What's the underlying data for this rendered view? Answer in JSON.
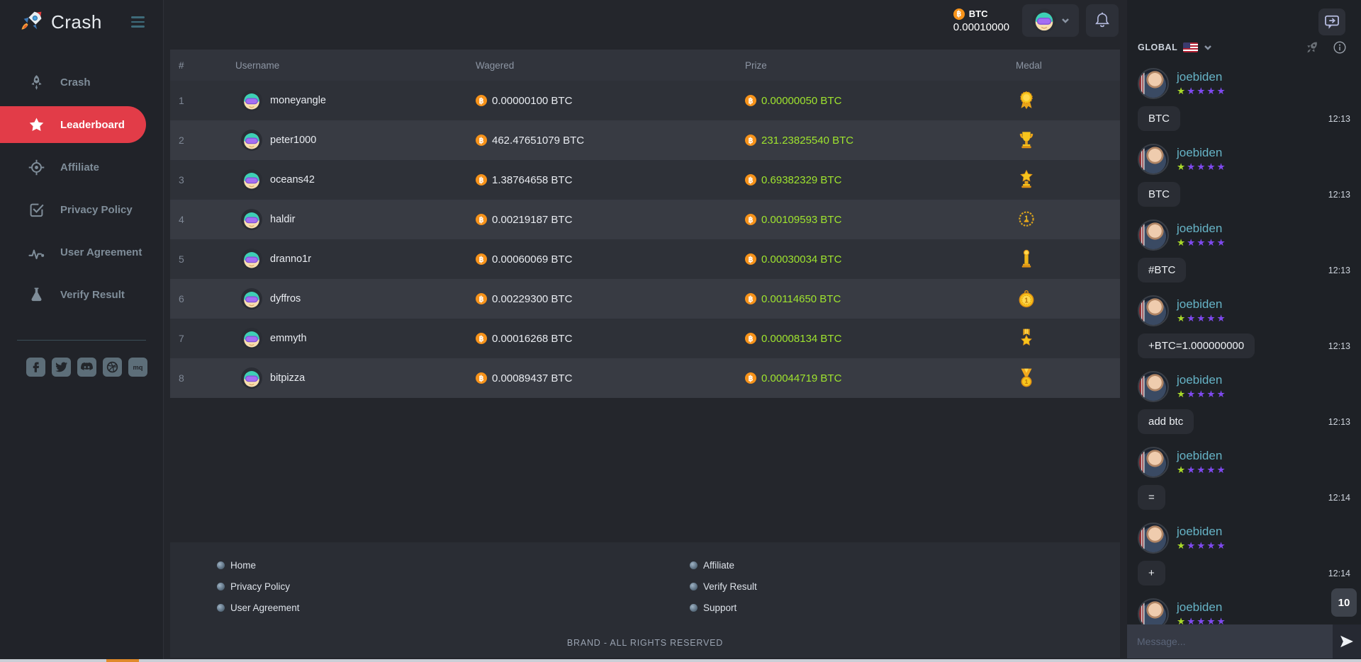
{
  "brand": {
    "logo_text": "Crash"
  },
  "topbar": {
    "balance": {
      "currency": "BTC",
      "amount": "0.00010000"
    }
  },
  "sidebar": {
    "items": [
      {
        "label": "Crash",
        "icon": "rocket",
        "active": false
      },
      {
        "label": "Leaderboard",
        "icon": "star",
        "active": true
      },
      {
        "label": "Affiliate",
        "icon": "target",
        "active": false
      },
      {
        "label": "Privacy Policy",
        "icon": "checkbox",
        "active": false
      },
      {
        "label": "User Agreement",
        "icon": "pulse",
        "active": false
      },
      {
        "label": "Verify Result",
        "icon": "flask",
        "active": false
      }
    ],
    "socials": [
      {
        "name": "facebook"
      },
      {
        "name": "twitter"
      },
      {
        "name": "discord"
      },
      {
        "name": "dribbble"
      },
      {
        "name": "mq"
      }
    ]
  },
  "leaderboard": {
    "columns": {
      "rank": "#",
      "username": "Username",
      "wagered": "Wagered",
      "prize": "Prize",
      "medal": "Medal"
    },
    "rows": [
      {
        "rank": "1",
        "username": "moneyangle",
        "wagered": "0.00000100 BTC",
        "prize": "0.00000050 BTC",
        "medal": "rosette"
      },
      {
        "rank": "2",
        "username": "peter1000",
        "wagered": "462.47651079 BTC",
        "prize": "231.23825540 BTC",
        "medal": "trophy"
      },
      {
        "rank": "3",
        "username": "oceans42",
        "wagered": "1.38764658 BTC",
        "prize": "0.69382329 BTC",
        "medal": "star-trophy"
      },
      {
        "rank": "4",
        "username": "haldir",
        "wagered": "0.00219187 BTC",
        "prize": "0.00109593 BTC",
        "medal": "laurel"
      },
      {
        "rank": "5",
        "username": "dranno1r",
        "wagered": "0.00060069 BTC",
        "prize": "0.00030034 BTC",
        "medal": "pillar"
      },
      {
        "rank": "6",
        "username": "dyffros",
        "wagered": "0.00229300 BTC",
        "prize": "0.00114650 BTC",
        "medal": "coin"
      },
      {
        "rank": "7",
        "username": "emmyth",
        "wagered": "0.00016268 BTC",
        "prize": "0.00008134 BTC",
        "medal": "star-ribbon"
      },
      {
        "rank": "8",
        "username": "bitpizza",
        "wagered": "0.00089437 BTC",
        "prize": "0.00044719 BTC",
        "medal": "ribbon"
      }
    ]
  },
  "footer": {
    "links_left": [
      "Home",
      "Privacy Policy",
      "User Agreement"
    ],
    "links_right": [
      "Affiliate",
      "Verify Result",
      "Support"
    ],
    "copyright": "BRAND - ALL RIGHTS RESERVED"
  },
  "chat": {
    "channel": "GLOBAL",
    "language_flag": "us-flag-icon",
    "rating": {
      "filled_green": 1,
      "total": 5
    },
    "messages": [
      {
        "user": "joebiden",
        "text": "BTC",
        "time": "12:13"
      },
      {
        "user": "joebiden",
        "text": "BTC",
        "time": "12:13"
      },
      {
        "user": "joebiden",
        "text": "#BTC",
        "time": "12:13"
      },
      {
        "user": "joebiden",
        "text": "+BTC=1.000000000",
        "time": "12:13"
      },
      {
        "user": "joebiden",
        "text": "add btc",
        "time": "12:13"
      },
      {
        "user": "joebiden",
        "text": "=",
        "time": "12:14"
      },
      {
        "user": "joebiden",
        "text": "+",
        "time": "12:14"
      },
      {
        "user": "joebiden",
        "text": "",
        "time": ""
      }
    ],
    "unread_count": "10",
    "input_placeholder": "Message..."
  },
  "icons": {
    "topbar": [
      "btc-coin-icon",
      "user-avatar",
      "chevron-down-icon",
      "bell-icon"
    ],
    "sidebar": [
      "rocket-icon",
      "star-icon",
      "target-icon",
      "checkbox-icon",
      "pulse-icon",
      "flask-icon",
      "hamburger-icon",
      "facebook-icon",
      "twitter-icon",
      "discord-icon",
      "dribbble-icon",
      "mq-icon"
    ],
    "chat": [
      "chat-toggle-icon",
      "us-flag-icon",
      "chevron-down-icon",
      "rocket-icon",
      "info-icon",
      "send-icon"
    ],
    "medals": [
      "rosette",
      "trophy",
      "star-trophy",
      "laurel",
      "pillar",
      "coin",
      "star-ribbon",
      "ribbon"
    ]
  },
  "colors": {
    "accent_red": "#e23c48",
    "prize_green": "#9fe42e",
    "btc_orange": "#f7931a",
    "username_teal": "#66b3c6",
    "star_green": "#a8d829",
    "star_purple": "#7e49ee",
    "scroll_thumb_orange": "#df8a2b"
  }
}
